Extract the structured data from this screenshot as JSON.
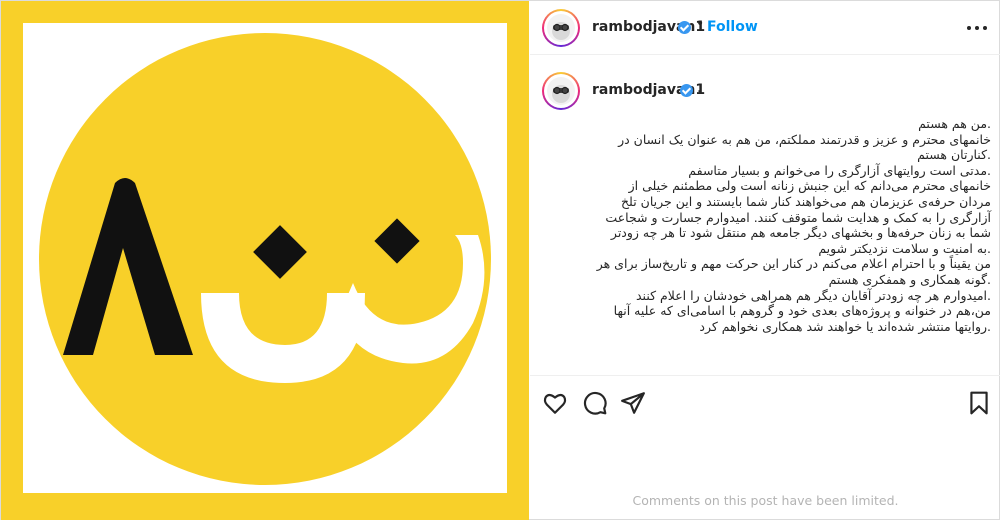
{
  "post": {
    "author": {
      "username": "rambodjavan1",
      "verified": true
    },
    "header": {
      "follow_label": "Follow",
      "separator": "•"
    },
    "caption": {
      "username": "rambodjavan1",
      "trailing": ".",
      "lines": [
        ".من هم هستم",
        "خانمهای محترم و عزیز و قدرتمند مملکتم، من هم به عنوان یک انسان در",
        ".کنارتان هستم",
        ".مدتی است روایتهای آزارگری را می‌خوانم و بسیار متاسفم",
        "خانمهای محترم می‌دانم که این جنبش زنانه است ولی مطمئنم خیلی از",
        "مردان حرفه‌ی عزیزمان هم می‌خواهند کنار شما بایستند و این جریان تلخ",
        "آزارگری را به کمک و هدایت شما متوقف کنند. امیدوارم جسارت و شجاعت",
        "شما به زنان حرفه‌ها و بخشهای دیگر جامعه هم منتقل شود تا هر چه زودتر",
        ".به امنیت و سلامت نزدیکتر شویم",
        "من یقیناً و با احترام اعلام می‌کنم در کنار این حرکت مهم و تاریخ‌ساز برای هر",
        ".گونه همکاری و همفکری هستم",
        ".امیدوارم هر چه زودتر آقایان دیگر هم همراهی خودشان را اعلام کنند",
        "من،هم در خنوانه و پروژه‌های بعدی خود و گروهم با اسامی‌ای که علیه آنها",
        ".روایتها منتشر شده‌اند یا خواهند شد همکاری نخواهم کرد"
      ]
    },
    "media": {
      "logo_text": "۸ زن",
      "colors": {
        "yellow": "#f8d029",
        "black": "#111111",
        "white": "#ffffff"
      }
    },
    "actions": {
      "like_icon": "heart-icon",
      "comment_icon": "comment-icon",
      "share_icon": "share-icon",
      "save_icon": "bookmark-icon"
    },
    "comments_status": "Comments on this post have been limited.",
    "colors": {
      "follow": "#0095f6",
      "verified": "#3897f0",
      "muted": "#b4b4b4"
    }
  }
}
